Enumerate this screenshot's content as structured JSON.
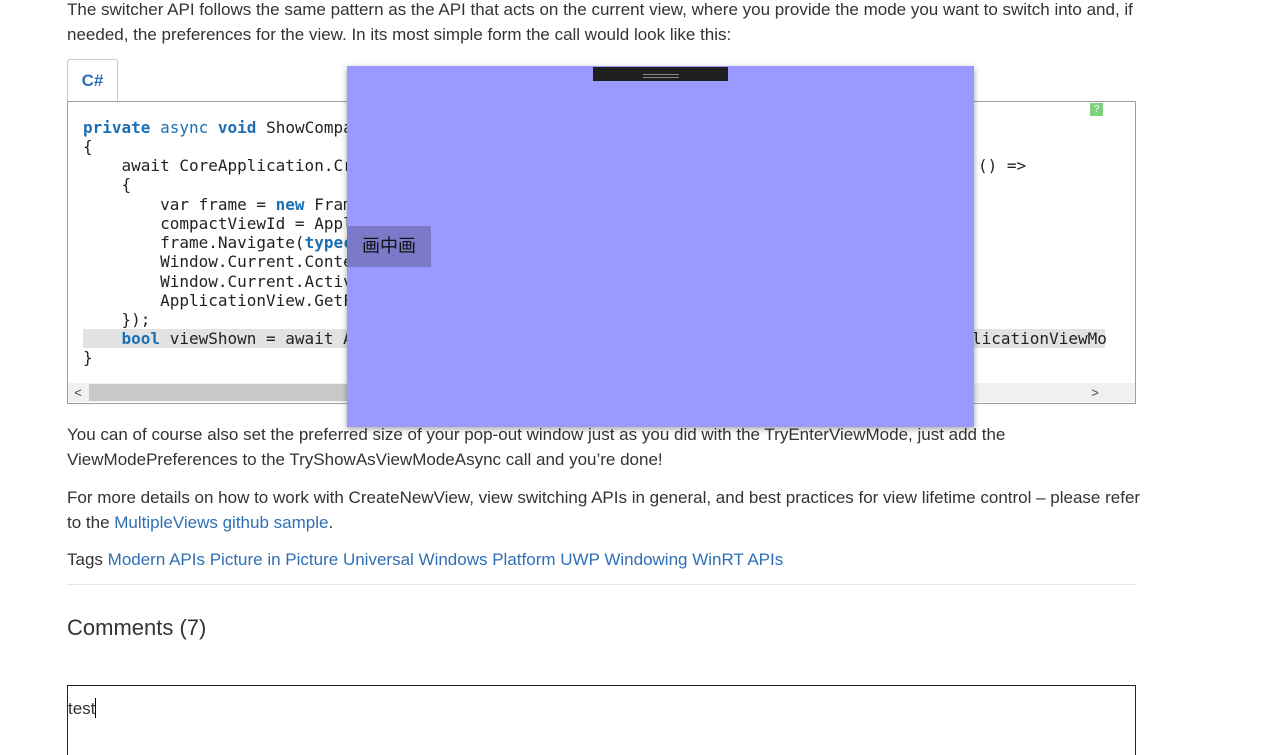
{
  "article": {
    "intro": "The switcher API follows the same pattern as the API that acts on the current view, where you provide the mode you want to switch into and, if needed, the preferences for the view. In its most simple form the call would look like this:",
    "para2": "You can of course also set the preferred size of your pop-out window just as you did with the TryEnterViewMode, just add the ViewModePreferences to the TryShowAsViewModeAsync call and you’re done!",
    "para3_before": "For more details on how to work with CreateNewView, view switching APIs in general, and best practices for view lifetime control – please refer to the ",
    "para3_link": "MultipleViews github sample",
    "para3_after": "."
  },
  "code": {
    "tab_label": "C#",
    "copy_label": "?",
    "lines": {
      "l1_kw1": "private",
      "l1_kw2": "async",
      "l1_kw3": "void",
      "l1_rest": "ShowCompa",
      "l2": "{",
      "l3": "    await CoreApplication.Cr",
      "l3_right": "() =>",
      "l4": "    {",
      "l5_pre": "        var frame = ",
      "l5_kw": "new",
      "l5_post": " Fram",
      "l6": "        compactViewId = Appl",
      "l7_pre": "        frame.Navigate(",
      "l7_kw": "typec",
      "l8": "        Window.Current.Conte",
      "l9": "        Window.Current.Activ",
      "l10": "        ApplicationView.GetF",
      "l11": "    });",
      "l12_kw": "bool",
      "l12_rest": " viewShown = await A",
      "l12_right": "licationViewMo",
      "l13": "}"
    },
    "scroll_left": "<",
    "scroll_right": ">"
  },
  "pip": {
    "button_label": "画中画"
  },
  "tags": {
    "label": "Tags",
    "items": [
      "Modern APIs",
      "Picture in Picture",
      "Universal Windows Platform",
      "UWP",
      "Windowing",
      "WinRT APIs"
    ]
  },
  "comments": {
    "title": "Comments (7)",
    "input_value": "test"
  },
  "colors": {
    "link": "#2f6fb5",
    "pip_background": "#9999ff",
    "pip_button": "#7a7ac8",
    "keyword": "#1c6fb5"
  }
}
